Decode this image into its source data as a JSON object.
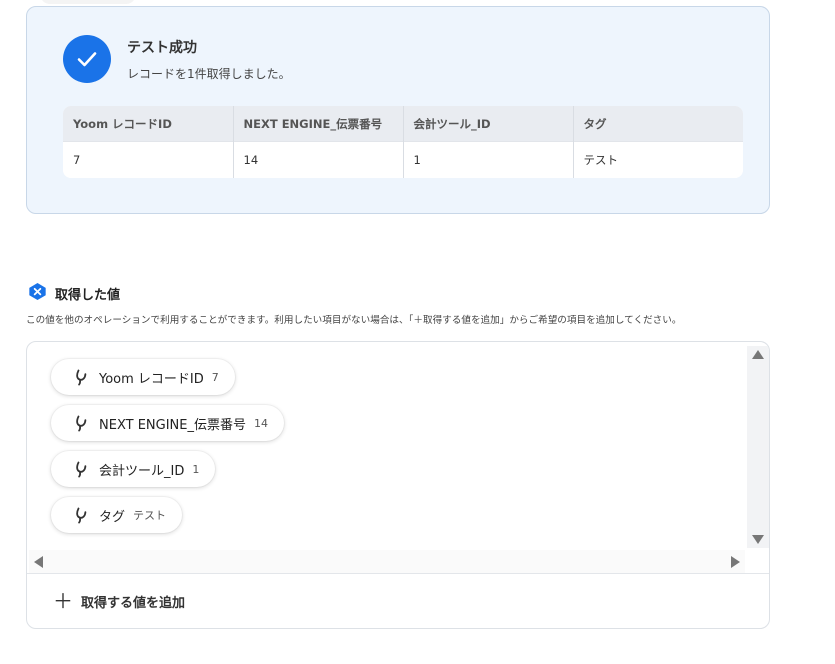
{
  "result": {
    "title": "テスト成功",
    "subtitle": "レコードを1件取得しました。",
    "table": {
      "headers": [
        "Yoom レコードID",
        "NEXT ENGINE_伝票番号",
        "会計ツール_ID",
        "タグ"
      ],
      "rows": [
        [
          "7",
          "14",
          "1",
          "テスト"
        ]
      ]
    }
  },
  "section": {
    "title": "取得した値",
    "description": "この値を他のオペレーションで利用することができます。利用したい項目がない場合は、「＋取得する値を追加」からご希望の項目を追加してください。"
  },
  "values": [
    {
      "label": "Yoom レコードID",
      "value": "7"
    },
    {
      "label": "NEXT ENGINE_伝票番号",
      "value": "14"
    },
    {
      "label": "会計ツール_ID",
      "value": "1"
    },
    {
      "label": "タグ",
      "value": "テスト"
    }
  ],
  "add_button": {
    "icon": "＋",
    "label": "取得する値を追加"
  },
  "colors": {
    "accent": "#1a73e8",
    "card_bg": "#eef5fd"
  },
  "icons": {
    "success": "check-circle-icon",
    "section": "variable-badge-icon",
    "chip": "variable-icon"
  }
}
